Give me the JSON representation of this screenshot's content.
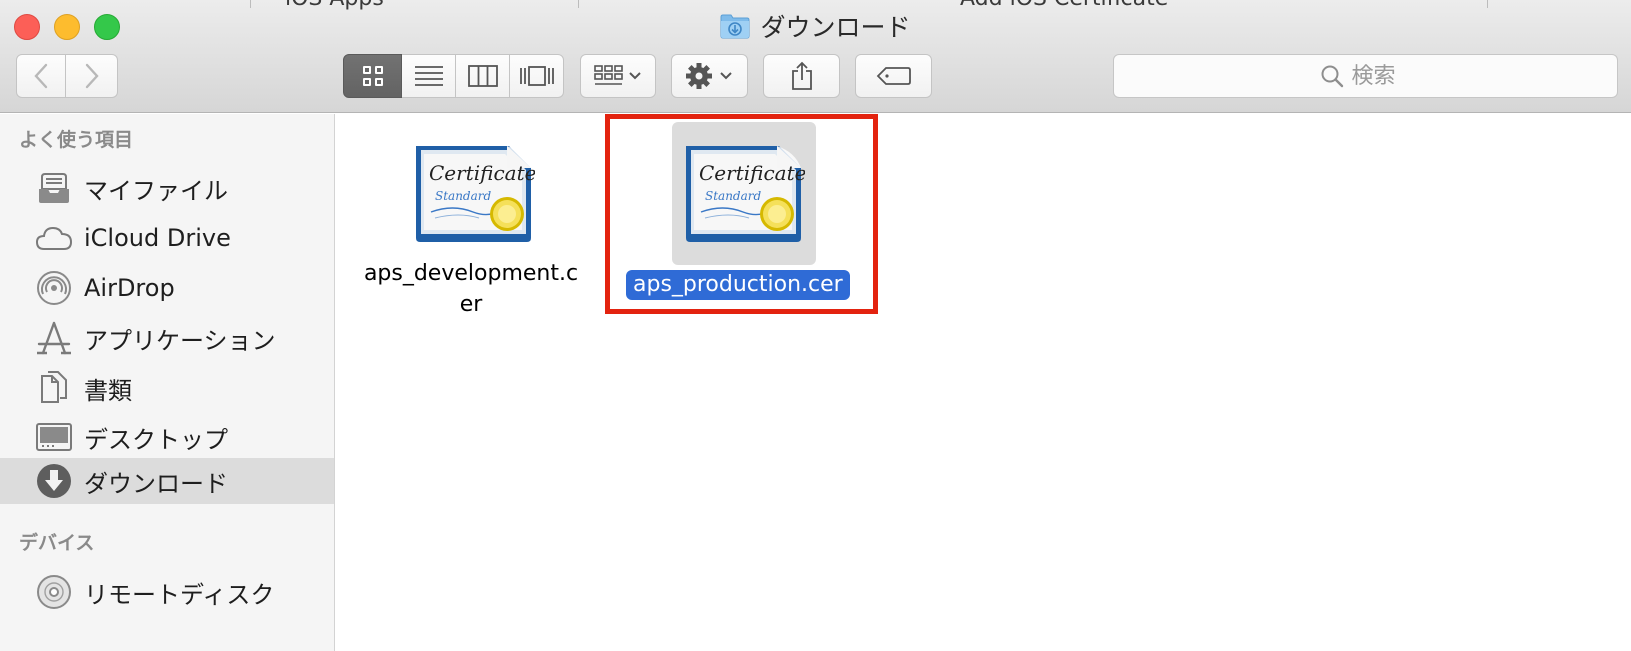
{
  "background_tabs": [
    "iOS Apps",
    "Add iOS Certificate"
  ],
  "window": {
    "title": "ダウンロード",
    "title_icon": "downloads-folder-icon"
  },
  "toolbar": {
    "back_icon": "chevron-left-icon",
    "forward_icon": "chevron-right-icon",
    "view_modes": [
      {
        "icon": "icon-view-icon",
        "active": true
      },
      {
        "icon": "list-view-icon",
        "active": false
      },
      {
        "icon": "column-view-icon",
        "active": false
      },
      {
        "icon": "coverflow-view-icon",
        "active": false
      }
    ],
    "arrange_icon": "arrange-grid-icon",
    "action_icon": "gear-icon",
    "share_icon": "share-icon",
    "tags_icon": "tag-icon",
    "search_placeholder": "検索"
  },
  "sidebar": {
    "favorites_header": "よく使う項目",
    "favorites": [
      {
        "label": "マイファイル",
        "icon": "all-my-files-icon",
        "selected": false
      },
      {
        "label": "iCloud Drive",
        "icon": "cloud-icon",
        "selected": false
      },
      {
        "label": "AirDrop",
        "icon": "airdrop-icon",
        "selected": false
      },
      {
        "label": "アプリケーション",
        "icon": "applications-icon",
        "selected": false
      },
      {
        "label": "書類",
        "icon": "documents-icon",
        "selected": false
      },
      {
        "label": "デスクトップ",
        "icon": "desktop-icon",
        "selected": false
      },
      {
        "label": "ダウンロード",
        "icon": "download-icon",
        "selected": true
      }
    ],
    "devices_header": "デバイス",
    "devices": [
      {
        "label": "リモートディスク",
        "icon": "remote-disc-icon",
        "selected": false
      }
    ]
  },
  "files": [
    {
      "name_line1": "aps_development.c",
      "name_line2": "er",
      "selected": false,
      "icon": "certificate-icon"
    },
    {
      "name": "aps_production.cer",
      "selected": true,
      "icon": "certificate-icon"
    }
  ],
  "colors": {
    "selection_blue": "#2f6bd6",
    "annotation_red": "#e3230f",
    "sidebar_selected": "#dcdcdc"
  }
}
